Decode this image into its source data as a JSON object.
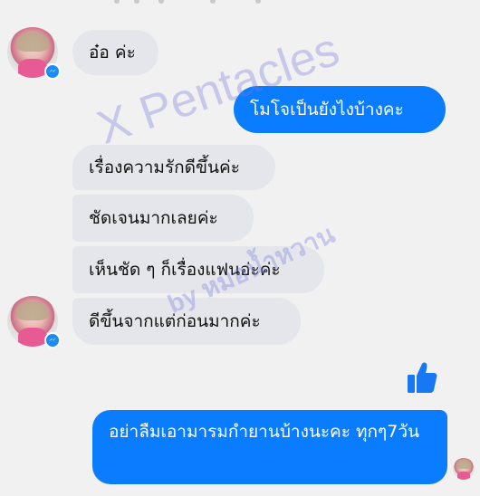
{
  "messages": [
    {
      "side": "in",
      "text": "อ๋อ ค่ะ"
    },
    {
      "side": "out",
      "text": "โมโจเป็นยังไงบ้างคะ"
    },
    {
      "side": "in",
      "text": "เรื่องความรักดีขึ้นค่ะ"
    },
    {
      "side": "in",
      "text": "ชัดเจนมากเลยค่ะ"
    },
    {
      "side": "in",
      "text": "เห็นชัด ๆ ก็เรื่องแฟนอ่ะค่ะ"
    },
    {
      "side": "in",
      "text": "ดีขึ้นจากแต่ก่อนมากค่ะ"
    },
    {
      "side": "out",
      "text": "อย่าลืมเอามารมกำยานบ้างนะคะ ทุกๆ7วัน"
    }
  ],
  "watermark": {
    "main": "X Pentacles",
    "sub": "by หมอน้ำหวาน"
  },
  "colors": {
    "background": "#f1f1f1",
    "incoming_bubble": "#e4e6eb",
    "outgoing_bubble": "#0a7cff",
    "messenger_badge": "#1c8cf5",
    "like_icon": "#1877f2"
  },
  "icons": {
    "like": "thumbs-up-icon",
    "badge": "messenger-badge-icon",
    "avatar": "contact-avatar"
  }
}
